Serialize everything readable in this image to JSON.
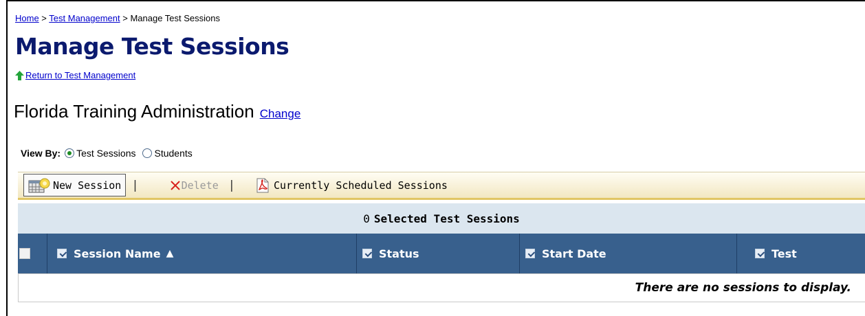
{
  "breadcrumb": {
    "home": "Home",
    "sep1": " > ",
    "test_management": "Test Management",
    "sep2": " > ",
    "current": "Manage Test Sessions"
  },
  "page": {
    "title": "Manage Test Sessions",
    "return_link": "Return to Test Management"
  },
  "admin": {
    "name": "Florida Training Administration",
    "change": "Change"
  },
  "view_by": {
    "label": "View By:",
    "options": [
      {
        "label": "Test Sessions",
        "checked": true
      },
      {
        "label": "Students",
        "checked": false
      }
    ]
  },
  "toolbar": {
    "new_session": "New Session",
    "sep": "|",
    "delete": "Delete",
    "scheduled": "Currently Scheduled Sessions"
  },
  "selection": {
    "count": "0",
    "label": "Selected Test Sessions"
  },
  "table": {
    "columns": [
      "Session Name",
      "Status",
      "Start Date",
      "Test"
    ],
    "sort_indicator": "▲",
    "empty_message": "There are no sessions to display."
  },
  "colors": {
    "title": "#0b1a6e",
    "header_bg": "#38608d",
    "selected_bar_bg": "#dbe6ef",
    "link": "#0000cc"
  }
}
